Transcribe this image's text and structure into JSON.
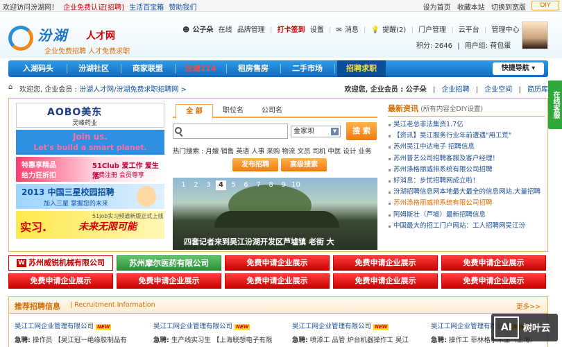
{
  "topbar": {
    "welcome": "欢迎访问汾湖网！",
    "cert": "企业免费认证[招聘]",
    "life": "生活百宝箱",
    "sponsor": "赞助我们",
    "homepage": "设为首页",
    "bookmark": "收藏本站",
    "wide": "切换到宽版",
    "diy": "DIY"
  },
  "logo": {
    "name": "汾湖",
    "sub": "人才网",
    "slogan": "企业免费招聘 人才免费求职"
  },
  "user": {
    "name": "公子朵",
    "status": "在线",
    "brand": "品牌管理",
    "checkin": "打卡签到",
    "settings": "设置",
    "messages": "消息",
    "reminders": "提醒(2)",
    "portal": "门户管理",
    "cloud": "云平台",
    "admin": "管理中心",
    "logout": "退出",
    "points": "积分: 2646",
    "group": "用户组: 荷包蛋"
  },
  "nav": {
    "items": [
      "入湖码头",
      "汾湖社区",
      "商家联盟",
      "汾湖114",
      "租房售房",
      "二手市场",
      "招聘求职"
    ],
    "quick": "快捷导航"
  },
  "breadcrumb": {
    "welcome": "欢迎您, 企业会员 :",
    "path": "汾湖人才网/汾湖免费求职招聘网 >",
    "right_welcome": "欢迎您, 企业会员 : 公子朵",
    "corp_recruit": "企业招聘",
    "corp_space": "企业空间",
    "resume": "简历库"
  },
  "online_service": "在线客服",
  "ads": {
    "ad1_title": "AOBO美东",
    "ad1_sub": "灵峰药业",
    "ad2_line1": "Join us.",
    "ad2_line2": "Let's build a smart planet.",
    "ad3_line1": "特惠享精品",
    "ad3_line2": "给力狂折扣",
    "ad3_line3": "51Club 爱工作 爱生活",
    "ad3_line4": "免费注册 会员尊享",
    "ad4_line1": "2013 中国三星校园招聘",
    "ad4_line2": "加入三星 掌握您的未来",
    "ad5_line1": "实习.",
    "ad5_line2": "未来无限可能",
    "ad5_line3": "51job实习频道新版正式上线"
  },
  "search": {
    "tabs": [
      "全 部",
      "职位名",
      "公司名"
    ],
    "placeholder": "",
    "area": "金家坝",
    "button": "搜 索",
    "hot_label": "热门搜索 :",
    "hot_terms": [
      "月嫂",
      "销售",
      "英语",
      "人事",
      "采购",
      "物流",
      "文员",
      "司机",
      "中医",
      "设计",
      "业务"
    ],
    "post": "发布招聘",
    "advanced": "高级搜索"
  },
  "slideshow": {
    "numbers": [
      "1",
      "2",
      "3",
      "4",
      "5",
      "6",
      "7",
      "8",
      "9",
      "10"
    ],
    "current": "4",
    "caption": "四套记者来到吴江汾湖开发区芦墟镇 老街 大"
  },
  "news": {
    "title": "最新资讯",
    "subtitle": "(所有内容全DIY设置)",
    "items": [
      "吴江老总非法集资1.7亿",
      "【资讯】吴江服务行业年前遭遇\"用工荒\"",
      "苏州吴江中达电子 招聘信息",
      "苏州普艺公司招聘客服及客户经理！",
      "苏州涤格丽威排系统有限公司招聘",
      "好消息：步忧招聘网成立啦！",
      "汾湖招聘信息网本地最大最全的信息网站,大量招聘",
      "苏州涤格丽威排系统有限公司招聘",
      "阿姆斯壮（芦墟）最新招聘信息",
      "中国最大的招工门户网站：工人招聘网吴江汾"
    ]
  },
  "companies": [
    "苏州威锐机械有限公司",
    "苏州摩尔医药有限公司",
    "免费申请企业展示",
    "免费申请企业展示",
    "免费申请企业展示",
    "免费申请企业展示",
    "免费申请企业展示",
    "免费申请企业展示",
    "免费申请企业展示",
    "免费申请企业展示"
  ],
  "recruit": {
    "title": "推荐招聘信息",
    "subtitle": "| Recruitment Information",
    "more": "更多>>",
    "new_badge": "NEW",
    "columns": [
      {
        "company": "吴江工网企业管理有限公司",
        "label": "急聘:",
        "jobs": "操作员 【吴江冠一绝缘胶制品有"
      },
      {
        "company": "吴江工网企业管理有限公司",
        "label": "急聘:",
        "jobs": "生产线实习生 【上海联想电子有限"
      },
      {
        "company": "吴江工网企业管理有限公司",
        "label": "急聘:",
        "jobs": "喷漆工 品管 炉台机器操作工 吴江"
      },
      {
        "company": "吴江工网企业管理有限公司",
        "label": "急聘:",
        "jobs": "操作工 菲林格尔木业（上海）"
      }
    ]
  },
  "watermark": {
    "box": "AI",
    "label": "树叶云"
  }
}
